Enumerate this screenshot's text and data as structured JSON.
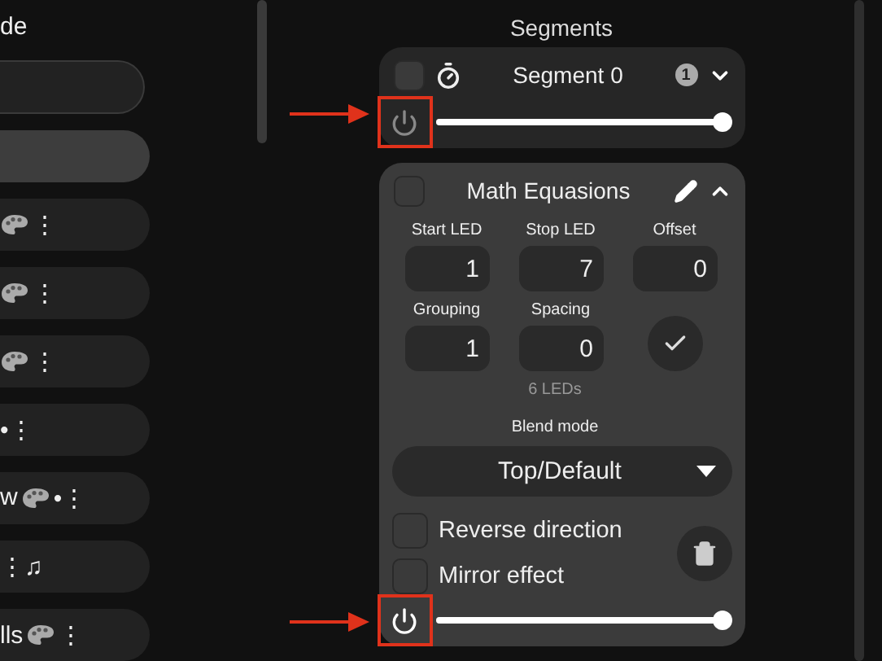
{
  "left_panel": {
    "heading": "de",
    "items": [
      {
        "kind": "field",
        "selected": false
      },
      {
        "kind": "item",
        "selected": true
      },
      {
        "kind": "item",
        "selected": false,
        "parts": [
          {
            "kind": "palette"
          },
          {
            "kind": "text",
            "text": "⋮"
          }
        ]
      },
      {
        "kind": "item",
        "selected": false,
        "parts": [
          {
            "kind": "palette"
          },
          {
            "kind": "text",
            "text": "⋮"
          }
        ]
      },
      {
        "kind": "item",
        "selected": false,
        "parts": [
          {
            "kind": "palette"
          },
          {
            "kind": "text",
            "text": "⋮"
          }
        ]
      },
      {
        "kind": "item",
        "selected": false,
        "parts": [
          {
            "kind": "text",
            "text": "•⋮"
          }
        ]
      },
      {
        "kind": "item",
        "selected": false,
        "parts": [
          {
            "kind": "text",
            "text": "w"
          },
          {
            "kind": "palette"
          },
          {
            "kind": "text",
            "text": "•⋮"
          }
        ]
      },
      {
        "kind": "item",
        "selected": false,
        "parts": [
          {
            "kind": "text",
            "text": "⋮♫"
          }
        ]
      },
      {
        "kind": "item",
        "selected": false,
        "parts": [
          {
            "kind": "text",
            "text": "lls"
          },
          {
            "kind": "palette"
          },
          {
            "kind": "text",
            "text": "⋮"
          }
        ]
      }
    ]
  },
  "segments": {
    "heading": "Segments",
    "items": [
      {
        "kind": "collapsed",
        "name": "Segment 0",
        "checked": false,
        "badge": "1",
        "expanded": false,
        "on": false,
        "level": 1,
        "annotated": true
      },
      {
        "kind": "expanded",
        "name": "Math Equasions",
        "checked": false,
        "expanded": true,
        "on": true,
        "level": 1,
        "annotated": true,
        "fields": [
          {
            "label": "Start LED",
            "value": "1"
          },
          {
            "label": "Stop LED",
            "value": "7"
          },
          {
            "label": "Offset",
            "value": "0"
          },
          {
            "label": "Grouping",
            "value": "1"
          },
          {
            "label": "Spacing",
            "value": "0"
          }
        ],
        "led_count": "6 LEDs",
        "blend_label": "Blend mode",
        "blend_value": "Top/Default",
        "options": [
          {
            "label": "Reverse direction",
            "checked": false
          },
          {
            "label": "Mirror effect",
            "checked": false
          }
        ]
      }
    ]
  }
}
